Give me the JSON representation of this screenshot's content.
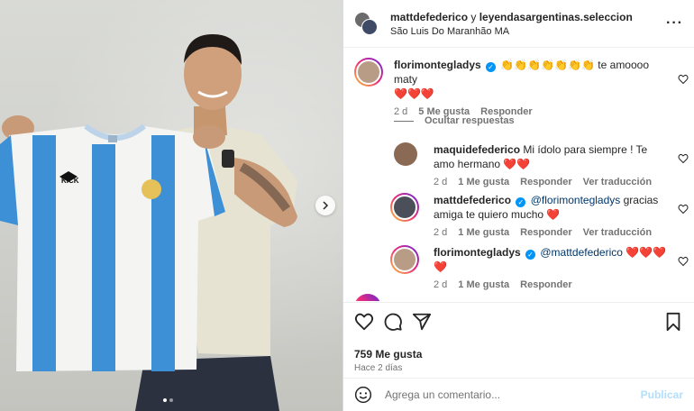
{
  "post": {
    "header": {
      "author": "mattdefederico",
      "connector": " y ",
      "coauthor": "leyendasargentinas.seleccion",
      "location": "São Luis Do Maranhão MA"
    },
    "photo": {
      "jersey_brand": "KICK",
      "slide_index": 1,
      "slide_count": 2
    },
    "comments": [
      {
        "username": "florimontegladys",
        "verified": true,
        "text": "👏👏👏👏👏👏👏 te amoooo maty",
        "hearts": "❤️❤️❤️",
        "time": "2 d",
        "likes": "5 Me gusta",
        "reply": "Responder"
      }
    ],
    "hide_replies": "Ocultar respuestas",
    "replies": [
      {
        "username": "maquidefederico",
        "text": "Mi ídolo para siempre ! Te amo hermano",
        "hearts": "❤️❤️",
        "time": "2 d",
        "likes": "1 Me gusta",
        "reply": "Responder",
        "translate": "Ver traducción"
      },
      {
        "username": "mattdefederico",
        "verified": true,
        "mention": "@florimontegladys",
        "text": "gracias amiga te quiero mucho",
        "hearts": "❤️",
        "time": "2 d",
        "likes": "1 Me gusta",
        "reply": "Responder",
        "translate": "Ver traducción"
      },
      {
        "username": "florimontegladys",
        "verified": true,
        "mention": "@mattdefederico",
        "hearts": "❤️❤️❤️❤️",
        "time": "2 d",
        "likes": "1 Me gusta",
        "reply": "Responder"
      }
    ],
    "likes_count": "759 Me gusta",
    "posted_ago": "Hace 2 días",
    "compose": {
      "placeholder": "Agrega un comentario...",
      "publish": "Publicar"
    }
  },
  "colors": {
    "accent_blue": "#0095f6",
    "publish_disabled": "#b2dffc",
    "heart_red": "#ed4956",
    "jersey_blue": "#3d8fd6"
  }
}
